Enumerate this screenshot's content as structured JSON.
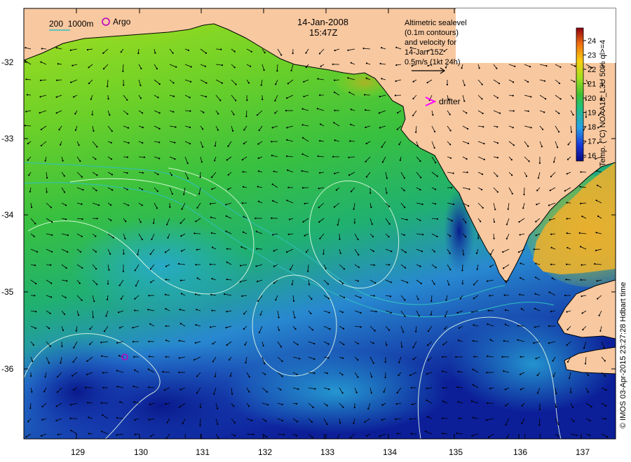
{
  "header": {
    "date": "14-Jan-2008",
    "time": "15:47Z"
  },
  "legend": {
    "isobath": "200  1000m",
    "argo": "Argo",
    "drifter": "drifter",
    "altimetry": [
      "Altimetric sealevel",
      "(0.1m contours)",
      "and velocity for",
      "14-Jan 15Z",
      "0.5m/s (1kt 24h)"
    ]
  },
  "colorbar": {
    "title": "Temp. (°C) NOAA18_L3U 50% ql>=4",
    "ticks": [
      "16",
      "17",
      "18",
      "19",
      "20",
      "21",
      "22",
      "23",
      "24"
    ]
  },
  "credit": "© IMOS 03-Apr-2015 23:27:28 Hdbart time",
  "axes": {
    "x_ticks": [
      "129",
      "130",
      "131",
      "132",
      "133",
      "134",
      "135",
      "136",
      "137"
    ],
    "y_ticks": [
      "-32",
      "-33",
      "-34",
      "-35",
      "-36"
    ]
  },
  "colors": {
    "land": "#f8c8a0",
    "sst_cold": "#0a1f9a",
    "sst_warm": "#f0a010",
    "drifter": "#ff00ff",
    "argo": "#c000c0",
    "isobath": "#30c0c0"
  }
}
